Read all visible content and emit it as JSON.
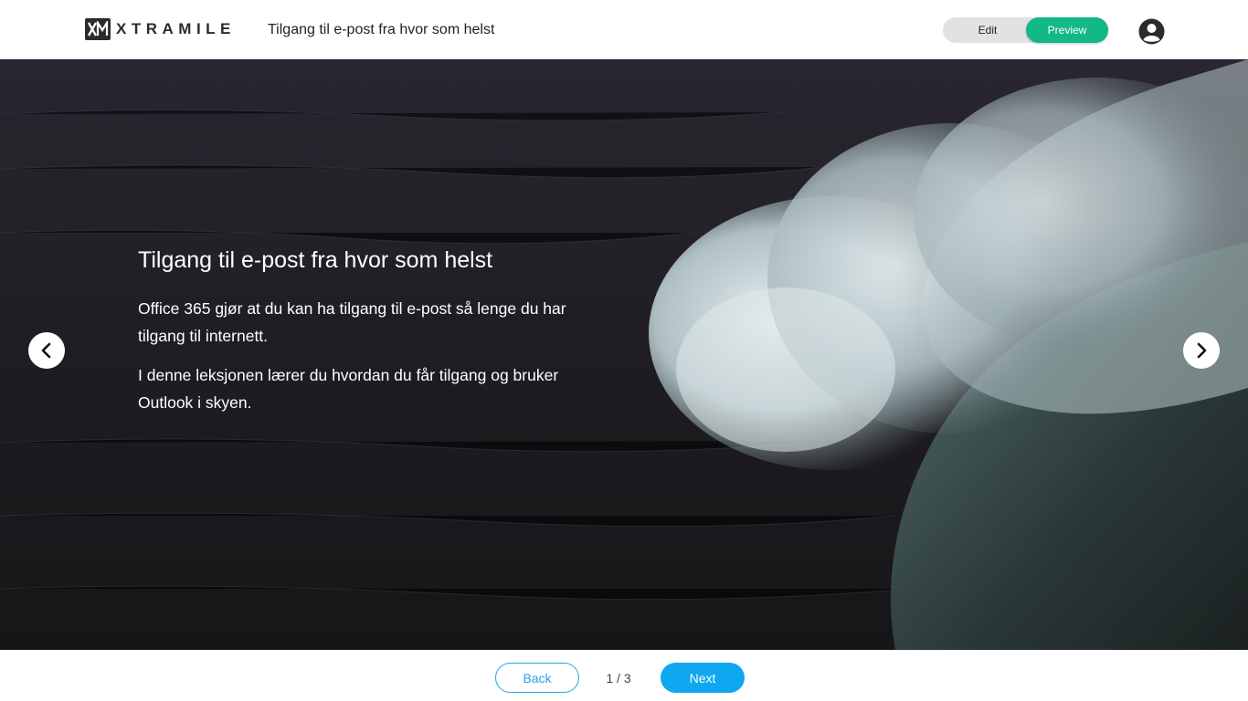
{
  "header": {
    "logo_text": "XTRAMILE",
    "logo_mark": "XM",
    "page_title": "Tilgang til e-post fra hvor som helst",
    "mode_edit_label": "Edit",
    "mode_preview_label": "Preview",
    "account_icon": "account-circle-icon"
  },
  "slide": {
    "title": "Tilgang til e-post fra hvor som helst",
    "paragraphs": [
      "Office 365 gjør at du kan ha tilgang til e-post så lenge du har tilgang til internett.",
      "I denne leksjonen lærer du hvordan du får tilgang og bruker Outlook i skyen."
    ],
    "prev_icon": "chevron-left-icon",
    "next_icon": "chevron-right-icon"
  },
  "footer": {
    "back_label": "Back",
    "pager_text": "1 / 3",
    "next_label": "Next"
  },
  "colors": {
    "accent_green": "#13b887",
    "accent_blue": "#0fa7ef",
    "hero_dark": "#1e1c21"
  }
}
